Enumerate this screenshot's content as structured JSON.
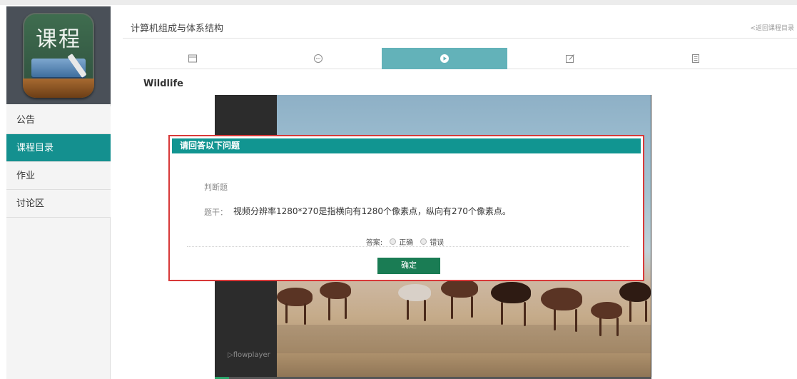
{
  "sidebar": {
    "logo_text": "课程",
    "items": [
      {
        "label": "公告",
        "active": false
      },
      {
        "label": "课程目录",
        "active": true
      },
      {
        "label": "作业",
        "active": false
      },
      {
        "label": "讨论区",
        "active": false
      }
    ]
  },
  "header": {
    "course_title": "计算机组成与体系结构",
    "back_link": "<返回课程目录"
  },
  "tabs": [
    {
      "icon": "calendar-icon",
      "active": false
    },
    {
      "icon": "chat-bubble-icon",
      "active": false
    },
    {
      "icon": "play-icon",
      "active": true
    },
    {
      "icon": "edit-icon",
      "active": false
    },
    {
      "icon": "document-icon",
      "active": false
    }
  ],
  "video": {
    "title": "Wildlife",
    "player_brand": "flowplayer"
  },
  "modal": {
    "title": "请回答以下问题",
    "question_type": "判断题",
    "stem_label": "题干：",
    "question_text": "视频分辨率1280*270是指横向有1280个像素点，纵向有270个像素点。",
    "answer_label": "答案:",
    "options": [
      "正确",
      "错误"
    ],
    "confirm_label": "确定"
  },
  "colors": {
    "accent": "#14908f",
    "tab_active": "#63b2b9",
    "confirm_button": "#1a7c54",
    "modal_highlight": "#d83939"
  }
}
